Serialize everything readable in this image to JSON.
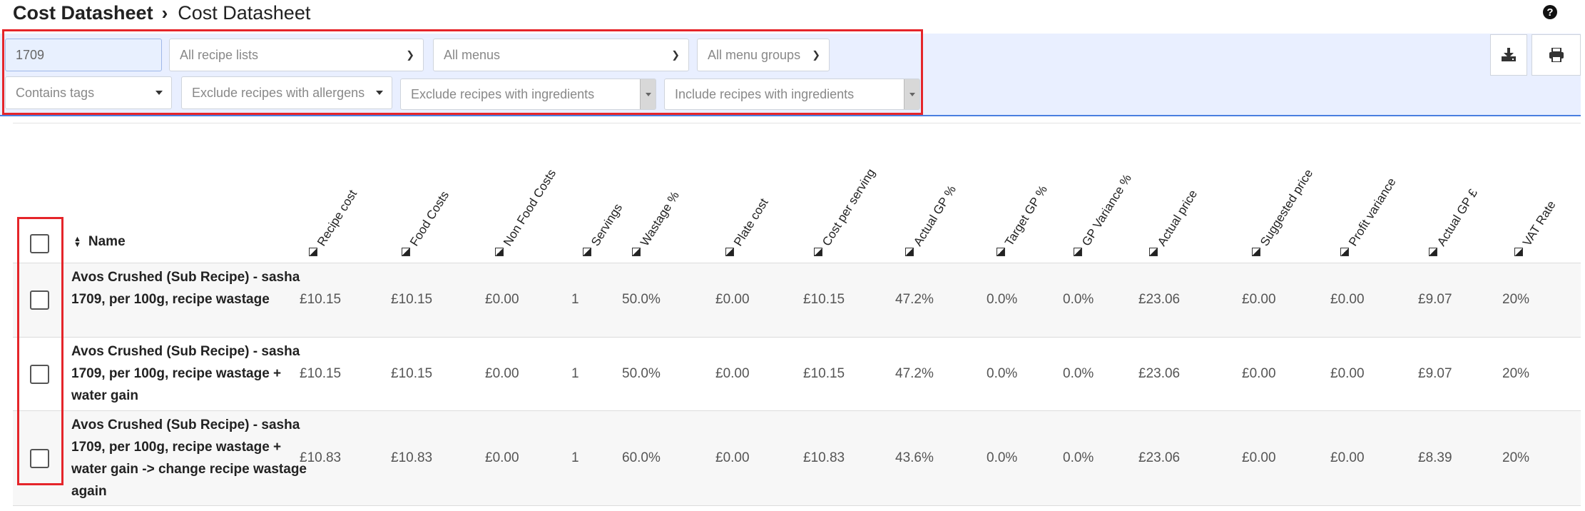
{
  "breadcrumb": {
    "root": "Cost Datasheet",
    "separator": "›",
    "current": "Cost Datasheet"
  },
  "help_icon": "?",
  "filters": {
    "search_value": "1709",
    "recipe_lists": "All recipe lists",
    "menus": "All menus",
    "menu_groups": "All menu groups",
    "tags": "Contains tags",
    "allergens": "Exclude recipes with allergens",
    "exclude_ingredients": "Exclude recipes with ingredients",
    "include_ingredients": "Include recipes with ingredients"
  },
  "toolbar": {
    "download_icon": "download-icon",
    "print_icon": "print-icon"
  },
  "table": {
    "name_header": "Name",
    "columns": [
      "Recipe cost",
      "Food Costs",
      "Non Food Costs",
      "Servings",
      "Wastage %",
      "Plate cost",
      "Cost per serving",
      "Actual GP %",
      "Target GP %",
      "GP Variance %",
      "Actual price",
      "Suggested price",
      "Profit variance",
      "Actual GP £",
      "VAT Rate"
    ],
    "rows": [
      {
        "name": "Avos Crushed (Sub Recipe) - sasha 1709, per 100g, recipe wastage",
        "values": [
          "£10.15",
          "£10.15",
          "£0.00",
          "1",
          "50.0%",
          "£0.00",
          "£10.15",
          "47.2%",
          "0.0%",
          "0.0%",
          "£23.06",
          "£0.00",
          "£0.00",
          "£9.07",
          "20%"
        ]
      },
      {
        "name": "Avos Crushed (Sub Recipe) - sasha 1709, per 100g, recipe wastage + water gain",
        "values": [
          "£10.15",
          "£10.15",
          "£0.00",
          "1",
          "50.0%",
          "£0.00",
          "£10.15",
          "47.2%",
          "0.0%",
          "0.0%",
          "£23.06",
          "£0.00",
          "£0.00",
          "£9.07",
          "20%"
        ]
      },
      {
        "name": "Avos Crushed (Sub Recipe) - sasha 1709, per 100g, recipe wastage + water gain -> change recipe wastage again",
        "values": [
          "£10.83",
          "£10.83",
          "£0.00",
          "1",
          "60.0%",
          "£0.00",
          "£10.83",
          "43.6%",
          "0.0%",
          "0.0%",
          "£23.06",
          "£0.00",
          "£0.00",
          "£8.39",
          "20%"
        ]
      }
    ]
  },
  "colors": {
    "accent_blue": "#4a7fe0",
    "filter_bg": "#e9efff",
    "highlight_red": "#e5252a"
  }
}
